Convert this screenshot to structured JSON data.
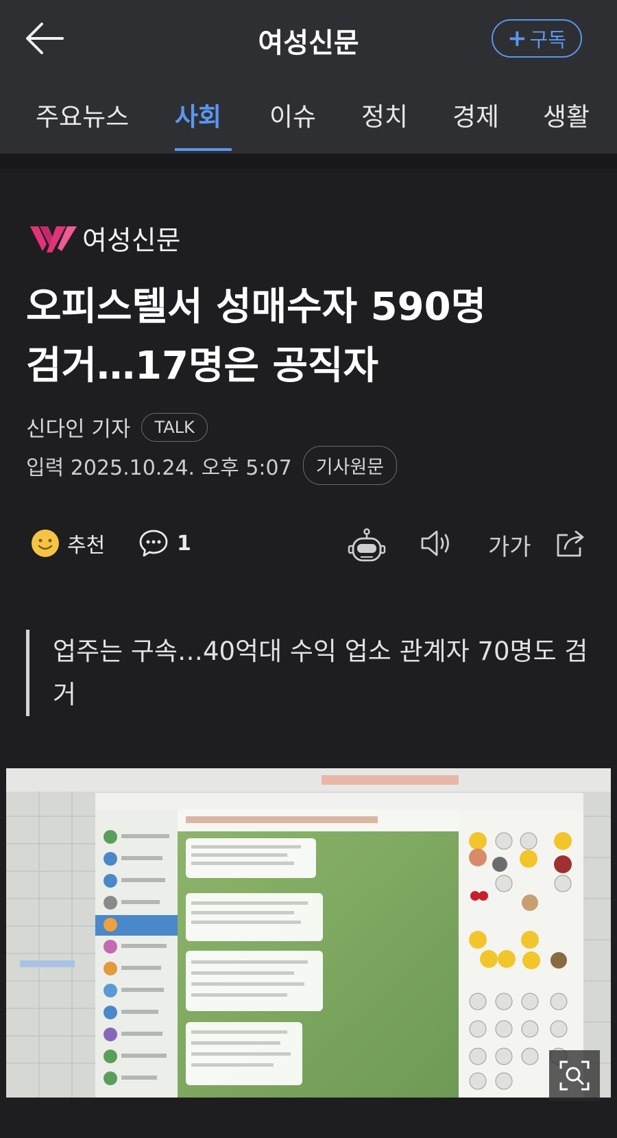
{
  "header": {
    "title": "여성신문",
    "subscribe_label": "구독",
    "tabs": [
      {
        "label": "주요뉴스"
      },
      {
        "label": "사회",
        "active": true
      },
      {
        "label": "이슈"
      },
      {
        "label": "정치"
      },
      {
        "label": "경제"
      },
      {
        "label": "생활"
      }
    ]
  },
  "article": {
    "publisher": "여성신문",
    "headline_line1": "오피스텔서 성매수자 590명",
    "headline_line2": "검거…17명은 공직자",
    "author": "신다인 기자",
    "talk_label": "TALK",
    "published": "입력 2025.10.24. 오후 5:07",
    "original_label": "기사원문",
    "summary": "업주는 구속…40억대 수익 업소 관계자 70명도 검거"
  },
  "actions": {
    "recommend_label": "추천",
    "comment_count": "1",
    "font_size_label": "가가"
  },
  "colors": {
    "accent": "#5a97f0",
    "background": "#1e1e20",
    "header_bg": "#2e2f33",
    "brand_pink": "#e0337a"
  },
  "icons": [
    "back-arrow-icon",
    "plus-icon",
    "smile-icon",
    "comment-icon",
    "robot-icon",
    "speaker-icon",
    "share-icon",
    "zoom-icon"
  ]
}
